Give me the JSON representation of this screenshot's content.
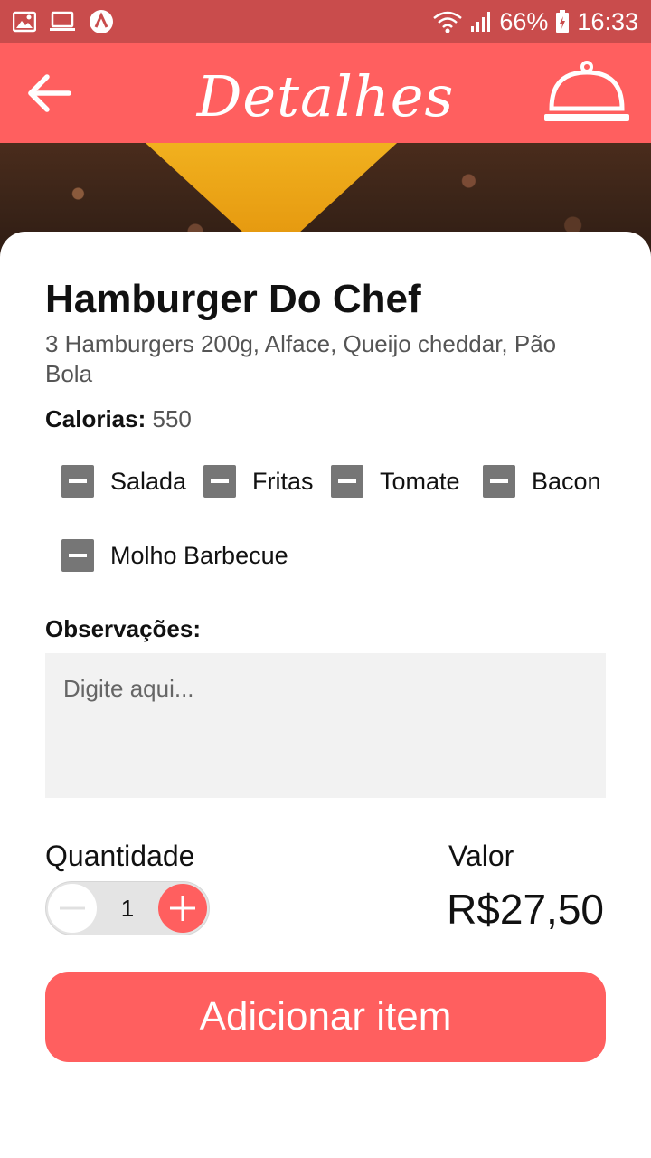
{
  "status_bar": {
    "battery": "66%",
    "time": "16:33",
    "icons": [
      "image-icon",
      "cast-icon",
      "app-badge-icon",
      "wifi-icon",
      "signal-icon",
      "battery-icon"
    ]
  },
  "header": {
    "title": "Detalhes",
    "back_icon": "arrow-left-icon",
    "cart_icon": "cloche-icon"
  },
  "product": {
    "name": "Hamburger Do Chef",
    "description": "3 Hamburgers 200g, Alface, Queijo cheddar, Pão Bola",
    "calories_label": "Calorias:",
    "calories_value": "550"
  },
  "options": [
    {
      "label": "Salada"
    },
    {
      "label": "Fritas"
    },
    {
      "label": "Tomate"
    },
    {
      "label": "Bacon"
    },
    {
      "label": "Molho Barbecue"
    }
  ],
  "observations": {
    "label": "Observações:",
    "placeholder": "Digite aqui...",
    "value": ""
  },
  "quantity": {
    "label": "Quantidade",
    "value": "1"
  },
  "price": {
    "label": "Valor",
    "value": "R$27,50"
  },
  "add_button": {
    "label": "Adicionar item"
  },
  "colors": {
    "status_bar": "#c94c4c",
    "accent": "#ff5f5f",
    "checkbox": "#767676"
  }
}
